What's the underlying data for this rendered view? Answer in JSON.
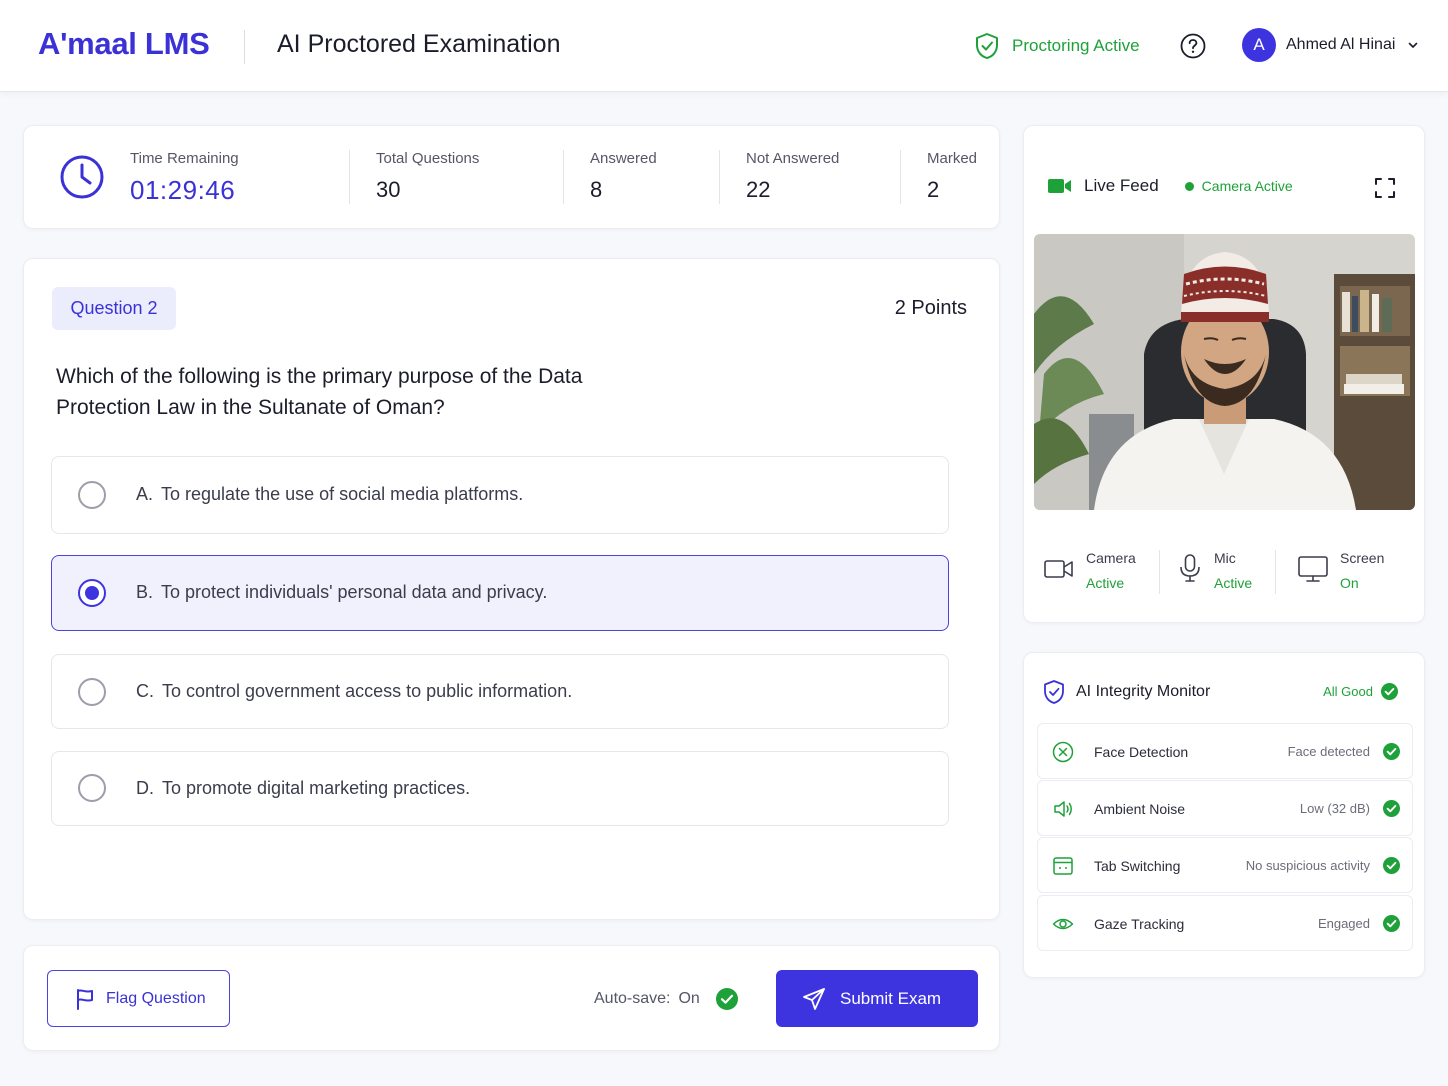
{
  "header": {
    "brand": "A'maal LMS",
    "title": "AI Proctored Examination",
    "proctoring_label": "Proctoring Active",
    "user_initial": "A",
    "user_name": "Ahmed Al Hinai"
  },
  "stats": {
    "time_label": "Time Remaining",
    "time_value": "01:29:46",
    "total_label": "Total Questions",
    "total_value": "30",
    "answered_label": "Answered",
    "answered_value": "8",
    "not_answered_label": "Not Answered",
    "not_answered_value": "22",
    "marked_label": "Marked",
    "marked_value": "2"
  },
  "question": {
    "badge": "Question 2",
    "points": "2 Points",
    "text": "Which of the following is the primary purpose of the Data Protection Law in the Sultanate of Oman?",
    "options": [
      {
        "letter": "A.",
        "text": "To regulate the use of social media platforms.",
        "selected": false
      },
      {
        "letter": "B.",
        "text": "To protect individuals' personal data and privacy.",
        "selected": true
      },
      {
        "letter": "C.",
        "text": "To control government access to public information.",
        "selected": false
      },
      {
        "letter": "D.",
        "text": "To promote digital marketing practices.",
        "selected": false
      }
    ]
  },
  "footer": {
    "flag_label": "Flag Question",
    "autosave_label": "Auto-save:",
    "autosave_value": "On",
    "submit_label": "Submit Exam"
  },
  "feed": {
    "title": "Live Feed",
    "camera_status": "Camera Active",
    "devices": [
      {
        "name": "Camera",
        "state": "Active",
        "icon": "video-camera-icon"
      },
      {
        "name": "Mic",
        "state": "Active",
        "icon": "microphone-icon"
      },
      {
        "name": "Screen",
        "state": "On",
        "icon": "monitor-icon"
      }
    ]
  },
  "monitor": {
    "title": "AI Integrity Monitor",
    "status": "All Good",
    "rows": [
      {
        "label": "Face Detection",
        "value": "Face detected",
        "icon": "face-scan-icon"
      },
      {
        "label": "Ambient Noise",
        "value": "Low (32 dB)",
        "icon": "speaker-icon"
      },
      {
        "label": "Tab Switching",
        "value": "No suspicious activity",
        "icon": "browser-tab-icon"
      },
      {
        "label": "Gaze Tracking",
        "value": "Engaged",
        "icon": "eye-icon"
      }
    ]
  },
  "colors": {
    "brand": "#3a32d6",
    "primary": "#3d34e0",
    "success": "#1fa13a"
  }
}
